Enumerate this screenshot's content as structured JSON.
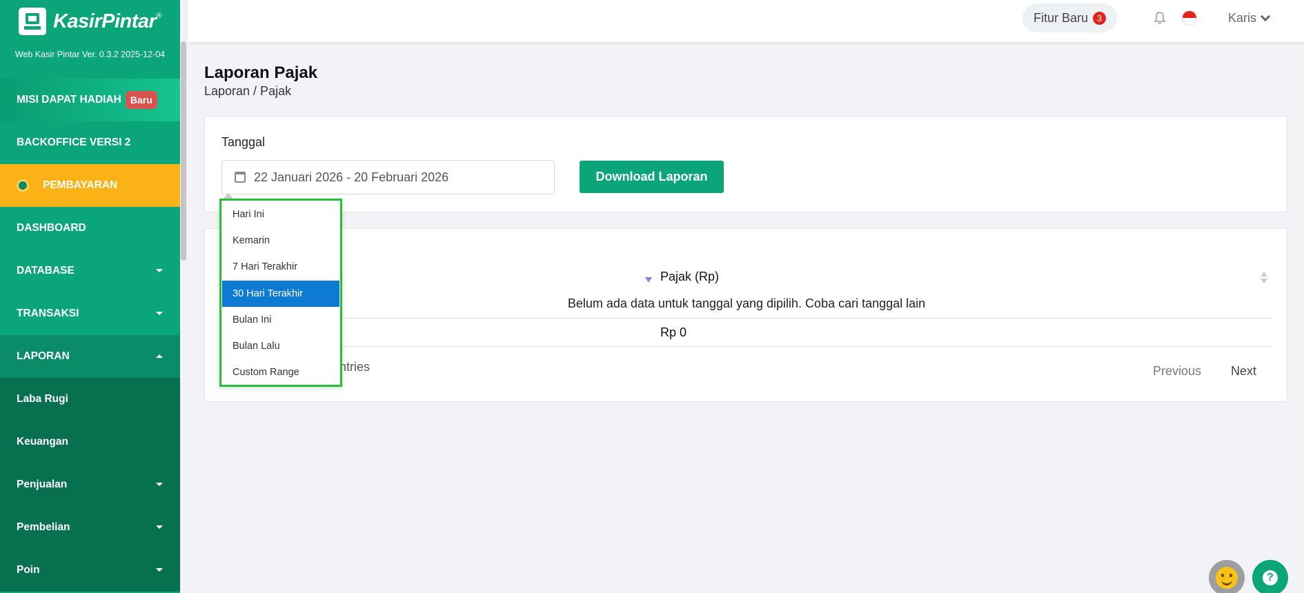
{
  "brand": {
    "name": "KasirPintar",
    "trademark": "®",
    "version": "Web Kasir Pintar Ver. 0.3.2 2025-12-04"
  },
  "sidebar": {
    "misi": {
      "label": "MISI DAPAT HADIAH",
      "badge": "Baru"
    },
    "backoffice": "BACKOFFICE VERSI 2",
    "pembayaran": "PEMBAYARAN",
    "dashboard": "DASHBOARD",
    "database": "DATABASE",
    "transaksi": "TRANSAKSI",
    "laporan": "LAPORAN",
    "laporan_items": [
      "Laba Rugi",
      "Keuangan",
      "Penjualan",
      "Pembelian",
      "Poin"
    ]
  },
  "topbar": {
    "fitur_label": "Fitur Baru",
    "fitur_count": "3",
    "user": "Karis"
  },
  "page": {
    "title": "Laporan Pajak",
    "breadcrumb": "Laporan / Pajak"
  },
  "filter": {
    "label": "Tanggal",
    "date_range": "22 Januari 2026 - 20 Februari 2026",
    "download_label": "Download Laporan"
  },
  "table": {
    "column": "Pajak (Rp)",
    "empty_message": "Belum ada data untuk tanggal yang dipilih. Coba cari tanggal lain",
    "total": "Rp 0",
    "entries_fragment": "entries",
    "previous": "Previous",
    "next": "Next"
  },
  "ranges": {
    "items": [
      "Hari Ini",
      "Kemarin",
      "7 Hari Terakhir",
      "30 Hari Terakhir",
      "Bulan Ini",
      "Bulan Lalu",
      "Custom Range"
    ],
    "selected": "30 Hari Terakhir"
  },
  "colors": {
    "primary": "#0aa67a",
    "payment": "#fbb217",
    "active_range": "#0d7bd3",
    "highlight_border": "#22c233"
  }
}
